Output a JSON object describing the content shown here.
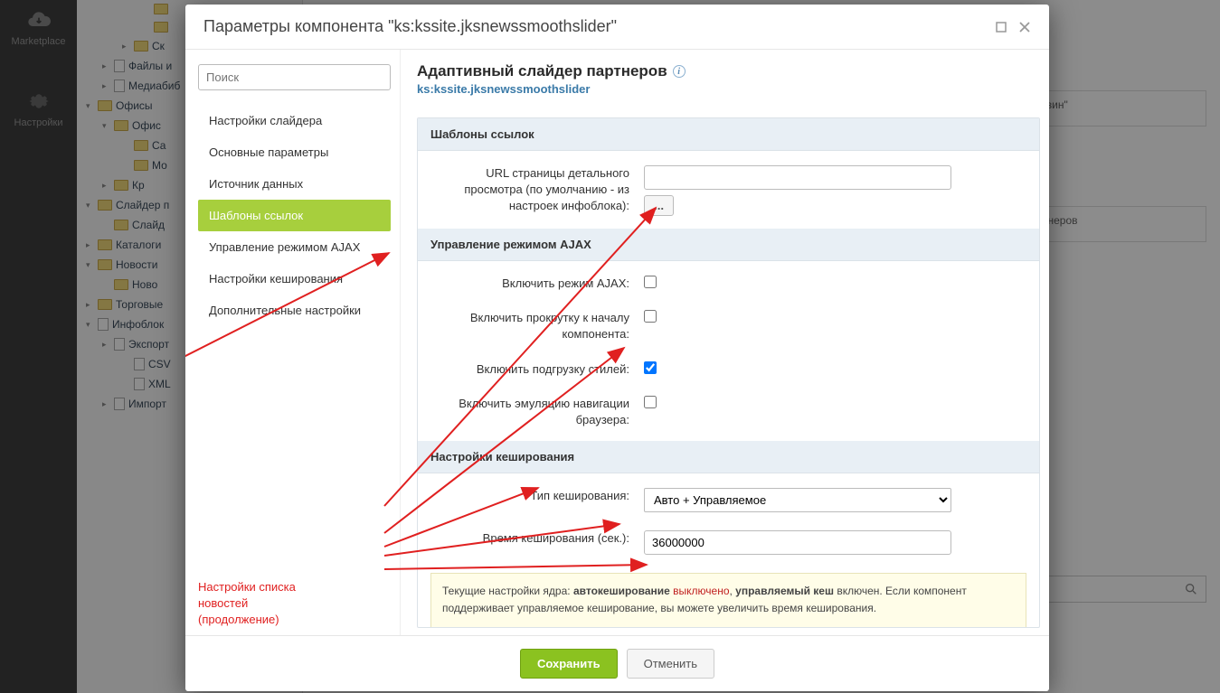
{
  "bg_sidebar": {
    "marketplace": "Marketplace",
    "settings": "Настройки"
  },
  "bg_tree": [
    {
      "level": 3,
      "exp": "",
      "icon": "fld",
      "label": ""
    },
    {
      "level": 3,
      "exp": "",
      "icon": "fld",
      "label": ""
    },
    {
      "level": 2,
      "exp": "▸",
      "icon": "fld",
      "label": "Ск"
    },
    {
      "level": 1,
      "exp": "▸",
      "icon": "doc",
      "label": "Файлы и"
    },
    {
      "level": 1,
      "exp": "▸",
      "icon": "doc",
      "label": "Медиабиб"
    },
    {
      "level": 0,
      "exp": "▾",
      "icon": "fld",
      "label": "Офисы"
    },
    {
      "level": 1,
      "exp": "▾",
      "icon": "fld",
      "label": "Офис"
    },
    {
      "level": 2,
      "exp": "",
      "icon": "fld",
      "label": "Са"
    },
    {
      "level": 2,
      "exp": "",
      "icon": "fld",
      "label": "Мо"
    },
    {
      "level": 1,
      "exp": "▸",
      "icon": "fld",
      "label": "Кр"
    },
    {
      "level": 0,
      "exp": "▾",
      "icon": "fld",
      "label": "Слайдер п"
    },
    {
      "level": 1,
      "exp": "",
      "icon": "fld",
      "label": "Слайд"
    },
    {
      "level": 0,
      "exp": "▸",
      "icon": "fld",
      "label": "Каталоги"
    },
    {
      "level": 0,
      "exp": "▾",
      "icon": "fld",
      "label": "Новости"
    },
    {
      "level": 1,
      "exp": "",
      "icon": "fld",
      "label": "Ново"
    },
    {
      "level": 0,
      "exp": "▸",
      "icon": "fld",
      "label": "Торговые"
    },
    {
      "level": 0,
      "exp": "▾",
      "icon": "doc",
      "label": "Инфоблок"
    },
    {
      "level": 1,
      "exp": "▸",
      "icon": "doc",
      "label": "Экспорт"
    },
    {
      "level": 2,
      "exp": "",
      "icon": "doc",
      "label": "CSV"
    },
    {
      "level": 2,
      "exp": "",
      "icon": "doc",
      "label": "XML"
    },
    {
      "level": 1,
      "exp": "▸",
      "icon": "doc",
      "label": "Импорт"
    }
  ],
  "bg_right": {
    "hint1": "рнет-магазин\"",
    "hint2": "идер партнеров"
  },
  "dialog": {
    "title": "Параметры компонента \"ks:kssite.jksnewssmoothslider\"",
    "search_placeholder": "Поиск",
    "nav_items": [
      "Настройки слайдера",
      "Основные параметры",
      "Источник данных",
      "Шаблоны ссылок",
      "Управление режимом AJAX",
      "Настройки кеширования",
      "Дополнительные настройки"
    ],
    "nav_active_index": 3,
    "annotation_line1": "Настройки списка",
    "annotation_line2": "новостей",
    "annotation_line3": "(продолжение)",
    "component_title": "Адаптивный слайдер партнеров",
    "component_code": "ks:kssite.jksnewssmoothslider",
    "sections": {
      "url_templates": {
        "head": "Шаблоны ссылок",
        "detail_url_label": "URL страницы детального просмотра (по умолчанию - из настроек инфоблока):",
        "detail_url_value": "",
        "dots": "..."
      },
      "ajax": {
        "head": "Управление режимом AJAX",
        "enable_label": "Включить режим AJAX:",
        "enable_checked": false,
        "scroll_label": "Включить прокрутку к началу компонента:",
        "scroll_checked": false,
        "styles_label": "Включить подгрузку стилей:",
        "styles_checked": true,
        "nav_label": "Включить эмуляцию навигации браузера:",
        "nav_checked": false
      },
      "cache": {
        "head": "Настройки кеширования",
        "type_label": "Тип кеширования:",
        "type_value": "Авто + Управляемое",
        "time_label": "Время кеширования (сек.):",
        "time_value": "36000000",
        "note_prefix": "Текущие настройки ядра: ",
        "note_autocache": "автокеширование ",
        "note_off": "выключено",
        "note_sep": ", ",
        "note_managed": "управляемый кеш",
        "note_on": " включен. Если компонент поддерживает управляемое кеширование, вы можете увеличить время кеширования."
      }
    },
    "footer": {
      "save": "Сохранить",
      "cancel": "Отменить"
    }
  }
}
